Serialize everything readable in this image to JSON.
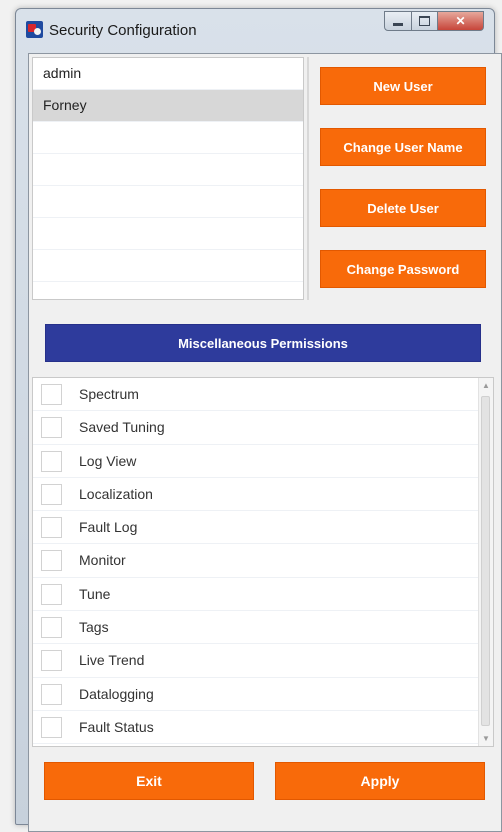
{
  "window": {
    "title": "Security Configuration"
  },
  "users": [
    {
      "name": "admin",
      "selected": false
    },
    {
      "name": "Forney",
      "selected": true
    },
    {
      "name": "",
      "selected": false
    },
    {
      "name": "",
      "selected": false
    },
    {
      "name": "",
      "selected": false
    },
    {
      "name": "",
      "selected": false
    },
    {
      "name": "",
      "selected": false
    }
  ],
  "actions": {
    "new_user": "New User",
    "change_user_name": "Change User Name",
    "delete_user": "Delete User",
    "change_password": "Change Password",
    "misc_permissions": "Miscellaneous Permissions",
    "exit": "Exit",
    "apply": "Apply"
  },
  "permissions": [
    {
      "label": "Spectrum",
      "checked": false
    },
    {
      "label": "Saved Tuning",
      "checked": false
    },
    {
      "label": "Log View",
      "checked": false
    },
    {
      "label": "Localization",
      "checked": false
    },
    {
      "label": "Fault Log",
      "checked": false
    },
    {
      "label": "Monitor",
      "checked": false
    },
    {
      "label": "Tune",
      "checked": false
    },
    {
      "label": "Tags",
      "checked": false
    },
    {
      "label": "Live Trend",
      "checked": false
    },
    {
      "label": "Datalogging",
      "checked": false
    },
    {
      "label": "Fault Status",
      "checked": false
    }
  ],
  "icons": {
    "app": "security-shield-icon",
    "minimize": "minimize-icon",
    "maximize": "maximize-icon",
    "close": "close-icon",
    "scroll_up": "scroll-up-arrow-icon",
    "scroll_down": "scroll-down-arrow-icon"
  },
  "colors": {
    "accent_orange": "#f86a0a",
    "accent_blue": "#2e3b9c",
    "selection": "#d7d7d7"
  }
}
